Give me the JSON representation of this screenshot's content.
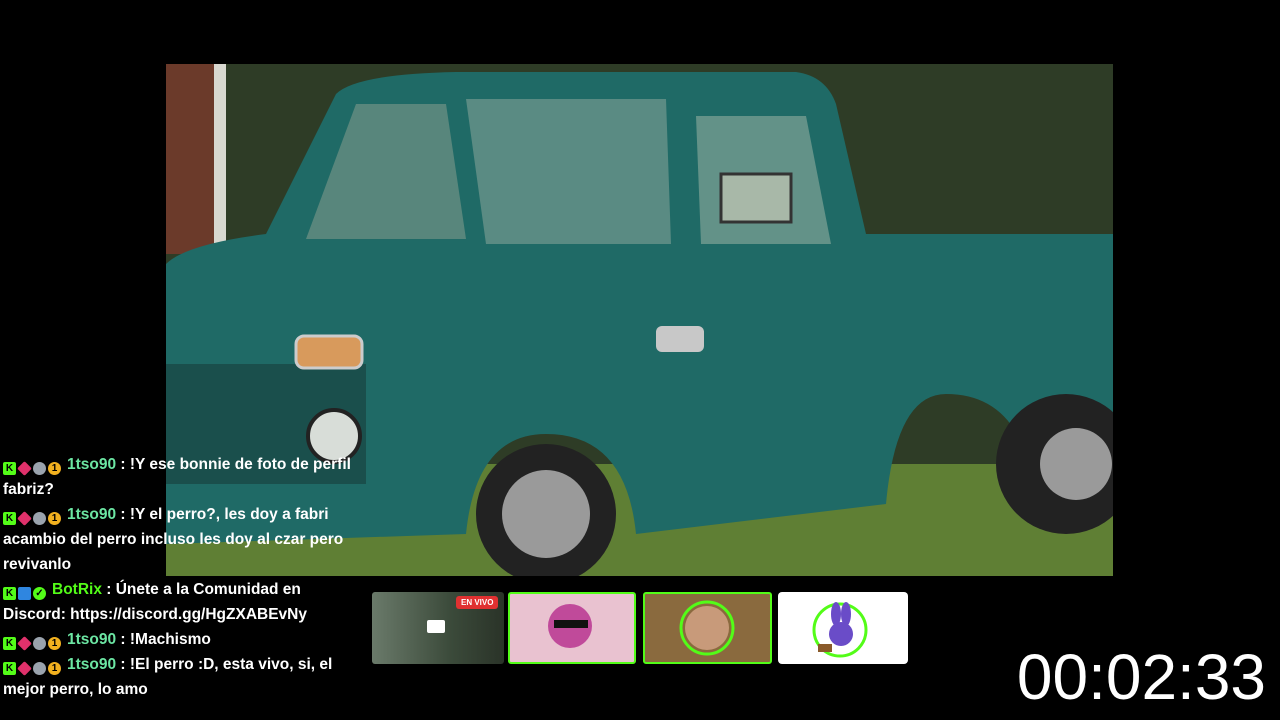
{
  "stream": {
    "live_label": "EN VIVO"
  },
  "timer": "00:02:33",
  "chat": [
    {
      "user": "1tso90",
      "badges": [
        "kick-icon",
        "cube-icon",
        "wolf-icon",
        "one-icon"
      ],
      "text": " : !Y ese bonnie de foto de perfil fabriz?"
    },
    {
      "user": "1tso90",
      "badges": [
        "kick-icon",
        "cube-icon",
        "wolf-icon",
        "one-icon"
      ],
      "text": " : !Y el perro?, les doy a fabri acambio del perro incluso les doy al czar pero revivanlo"
    },
    {
      "user": "BotRix",
      "badges": [
        "kick-icon",
        "bot-icon",
        "verified-icon"
      ],
      "text": " : Únete a la Comunidad en Discord: https://discord.gg/HgZXABEvNy"
    },
    {
      "user": "1tso90",
      "badges": [
        "kick-icon",
        "cube-icon",
        "wolf-icon",
        "one-icon"
      ],
      "text": " : !Machismo"
    },
    {
      "user": "1tso90",
      "badges": [
        "kick-icon",
        "cube-icon",
        "wolf-icon",
        "one-icon"
      ],
      "text": " : !El perro :D, esta vivo, si, el mejor perro, lo amo"
    }
  ],
  "colors": {
    "kick_green": "#53fc18",
    "live_red": "#e03131",
    "user_green": "#6ce6a3"
  }
}
